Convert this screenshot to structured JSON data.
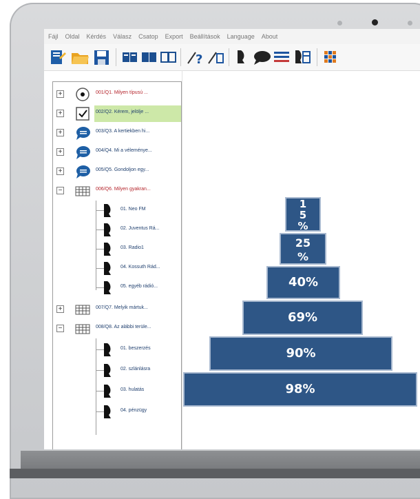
{
  "menu": [
    "Fájl",
    "Oldal",
    "Kérdés",
    "Válasz",
    "Csatop",
    "Export",
    "Beállítások",
    "Language",
    "About"
  ],
  "tree": {
    "rows": [
      {
        "label": "001/Q1. Milyen típusú ...",
        "icon": "radio-icon",
        "red": true
      },
      {
        "label": "002/Q2. Kérem, jelölje ...",
        "icon": "checkbox-icon",
        "highlight": true
      },
      {
        "label": "003/Q3. A kertiekben hi...",
        "icon": "speech-bubble-icon"
      },
      {
        "label": "004/Q4. Mi a véleménye...",
        "icon": "speech-bubble-icon"
      },
      {
        "label": "005/Q5. Gondoljon egy...",
        "icon": "speech-bubble-icon"
      },
      {
        "label": "006/Q6. Milyen gyakran...",
        "icon": "grid-icon",
        "red": true
      }
    ],
    "group1_children": [
      "01. Neo FM",
      "02. Juventus Rá...",
      "03. Radio1",
      "04. Kossuth Rád...",
      "05. egyéb rádió..."
    ],
    "row7": {
      "label": "007/Q7. Melyik mártuk...",
      "icon": "grid-icon"
    },
    "row8": {
      "label": "008/Q8. Az alábbi terüle...",
      "icon": "grid-icon"
    },
    "group2_children": [
      "01. beszerzés",
      "02. szlánlásra",
      "03. hulatás",
      "04. pénzügy"
    ]
  },
  "pyramid": {
    "levels": [
      "1\n5\n%",
      "25\n%",
      "40%",
      "69%",
      "90%",
      "98%"
    ]
  },
  "colors": {
    "pyramid": "#2e5686",
    "highlight": "#cde8a8",
    "accent_red": "#b4242b"
  }
}
